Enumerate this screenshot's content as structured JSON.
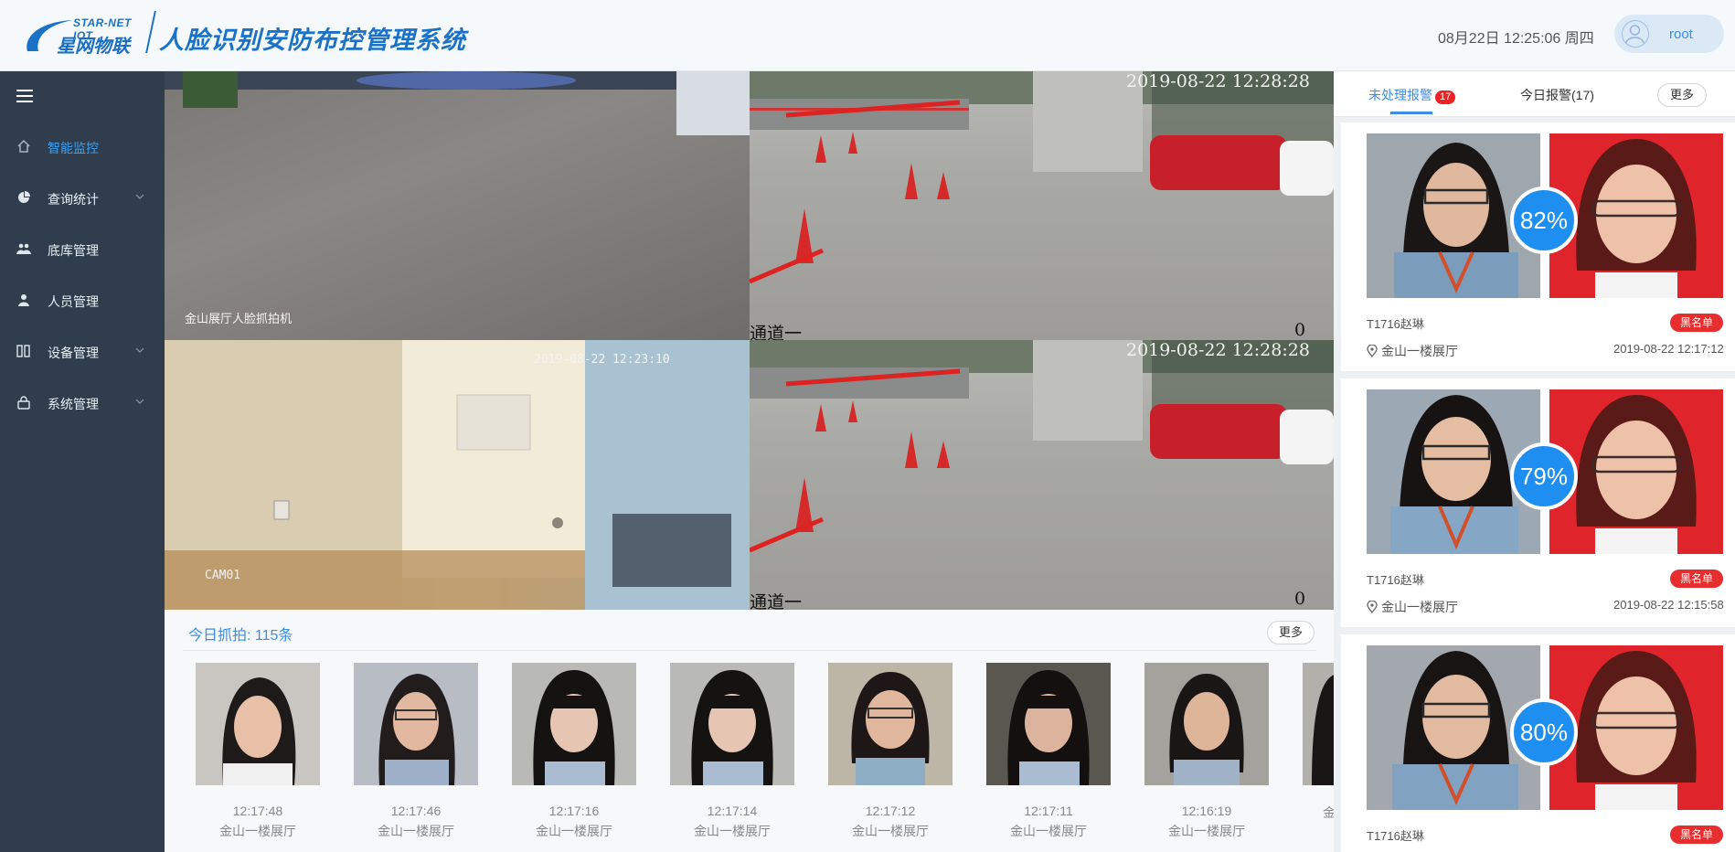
{
  "header": {
    "logo_en": "STAR-NET IOT",
    "logo_cn": "星网物联",
    "system_title": "人脸识别安防布控管理系统",
    "datetime": "08月22日 12:25:06 周四",
    "username": "root"
  },
  "sidebar": {
    "items": [
      {
        "label": "智能监控",
        "icon": "home-icon",
        "active": true
      },
      {
        "label": "查询统计",
        "icon": "pie-chart-icon",
        "expandable": true
      },
      {
        "label": "底库管理",
        "icon": "group-icon"
      },
      {
        "label": "人员管理",
        "icon": "user-icon"
      },
      {
        "label": "设备管理",
        "icon": "columns-icon",
        "expandable": true
      },
      {
        "label": "系统管理",
        "icon": "lock-icon",
        "expandable": true
      }
    ]
  },
  "videos": {
    "v1": {
      "label": "金山展厅人脸抓拍机"
    },
    "v2": {
      "timestamp": "2019-08-22 12:28:28",
      "channel": "通道一",
      "index": "0"
    },
    "v3": {
      "timestamp": "2019-08-22 12:23:10",
      "label": "CAM01"
    },
    "v4": {
      "timestamp": "2019-08-22 12:28:28",
      "channel": "通道一",
      "index": "0"
    }
  },
  "captures": {
    "title": "今日抓拍: 115条",
    "more": "更多",
    "items": [
      {
        "time": "12:17:48",
        "location": "金山一楼展厅"
      },
      {
        "time": "12:17:46",
        "location": "金山一楼展厅"
      },
      {
        "time": "12:17:16",
        "location": "金山一楼展厅"
      },
      {
        "time": "12:17:14",
        "location": "金山一楼展厅"
      },
      {
        "time": "12:17:12",
        "location": "金山一楼展厅"
      },
      {
        "time": "12:17:11",
        "location": "金山一楼展厅"
      },
      {
        "time": "12:16:19",
        "location": "金山一楼展厅"
      },
      {
        "time": "",
        "location": "金"
      }
    ]
  },
  "alarms": {
    "tab_unhandled": "未处理报警",
    "unhandled_count": "17",
    "tab_today": "今日报警(17)",
    "more": "更多",
    "cards": [
      {
        "score": "82%",
        "name": "T1716赵琳",
        "tag": "黑名单",
        "location": "金山一楼展厅",
        "datetime": "2019-08-22 12:17:12"
      },
      {
        "score": "79%",
        "name": "T1716赵琳",
        "tag": "黑名单",
        "location": "金山一楼展厅",
        "datetime": "2019-08-22 12:15:58"
      },
      {
        "score": "80%",
        "name": "T1716赵琳",
        "tag": "黑名单",
        "location": "",
        "datetime": ""
      }
    ]
  },
  "colors": {
    "accent": "#3a8ee6",
    "sidebar_bg": "#2f3d4c",
    "blacklist_red": "#e62e2e",
    "score_blue": "#1e8ff0"
  }
}
